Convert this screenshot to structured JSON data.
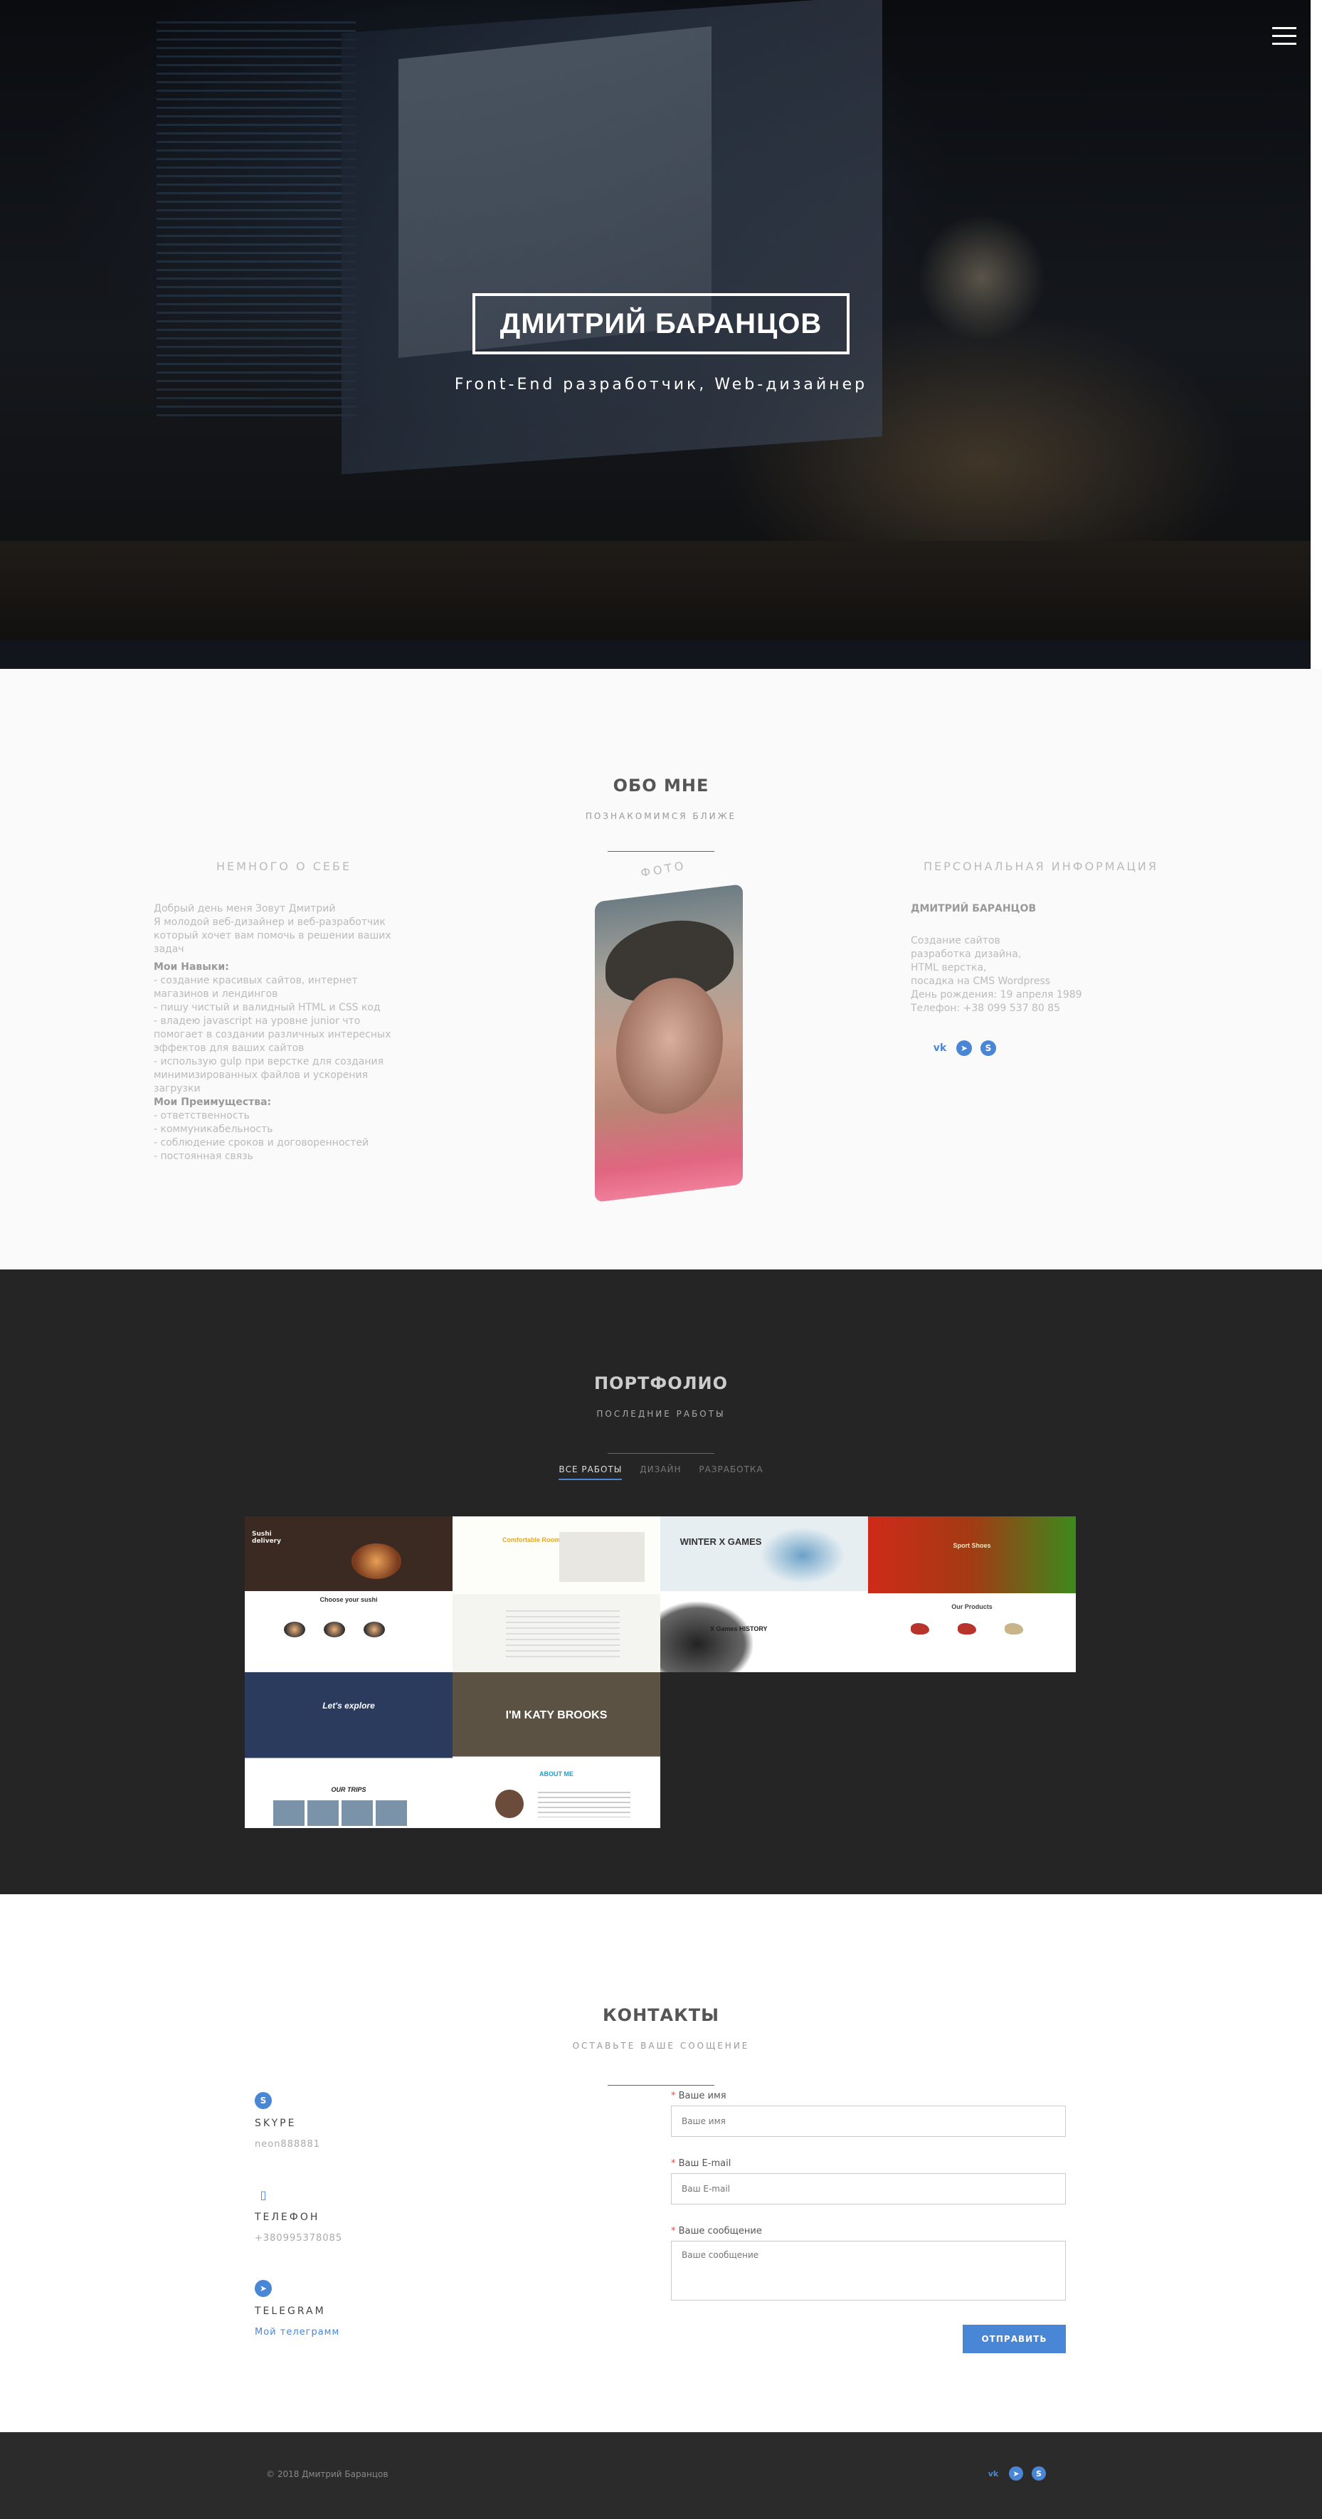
{
  "hero": {
    "title": "ДМИТРИЙ БАРАНЦОВ",
    "subtitle": "Front-End разработчик, Web-дизайнер",
    "menu_icon": "hamburger-icon"
  },
  "about": {
    "title": "ОБО МНЕ",
    "subtitle": "ПОЗНАКОМИМСЯ БЛИЖЕ",
    "left_heading": "НЕМНОГО О СЕБЕ",
    "intro": "Добрый день меня Зовут Дмитрий\nЯ молодой веб-дизайнер и веб-разработчик который хочет вам помочь в решении ваших задач",
    "skills_heading": "Мои Навыки:",
    "skills": [
      "- создание красивых сайтов, интернет магазинов и лендингов",
      "- пишу чистый и валидный HTML и CSS код",
      "- владею javascript на уровне junior что помогает в создании различных интересных эффектов для ваших сайтов",
      "- использую gulp при верстке для создания минимизированных файлов и ускорения загрузки"
    ],
    "advantages_heading": "Мои Преимущества:",
    "advantages": [
      "- ответственность",
      "- коммуникабельность",
      "- соблюдение сроков и договоренностей",
      "- постоянная связь"
    ],
    "photo_label": "ФОТО",
    "right_heading": "ПЕРСОНАЛЬНАЯ ИНФОРМАЦИЯ",
    "name": "ДМИТРИЙ БАРАНЦОВ",
    "info": [
      "Создание сайтов",
      "разработка дизайна,",
      "HTML верстка,",
      "посадка на CMS Wordpress",
      "День рождения: 19 апреля 1989",
      "Телефон: +38 099 537 80 85"
    ],
    "socials": [
      "vk-icon",
      "telegram-icon",
      "skype-icon"
    ]
  },
  "portfolio": {
    "title": "ПОРТФОЛИО",
    "subtitle": "ПОСЛЕДНИЕ РАБОТЫ",
    "filters": [
      "ВСЕ РАБОТЫ",
      "ДИЗАЙН",
      "РАЗРАБОТКА"
    ],
    "active_filter": "ВСЕ РАБОТЫ",
    "tiles": {
      "t1_header": "Sushi delivery",
      "t1_label": "Choose your sushi",
      "t2_label": "Comfortable Rooms",
      "t3_label": "WINTER X GAMES",
      "t3_label2": "X Games HISTORY",
      "t4_label": "Sport Shoes",
      "t4_label2": "Our Products",
      "t5_label": "Let's explore",
      "t5_label2": "OUR TRIPS",
      "t6_label": "I'M KATY BROOKS",
      "t6_label2": "ABOUT ME"
    }
  },
  "contacts": {
    "title": "КОНТАКТЫ",
    "subtitle": "ОСТАВЬТЕ ВАШЕ СООЩЕНИЕ",
    "skype_label": "SKYPE",
    "skype_value": "neon888881",
    "phone_label": "ТЕЛЕФОН",
    "phone_value": "+380995378085",
    "telegram_label": "TELEGRAM",
    "telegram_value": "Мой телеграмм",
    "form": {
      "name_label": "Ваше имя",
      "name_placeholder": "Ваше имя",
      "email_label": "Ваш E-mail",
      "email_placeholder": "Ваш E-mail",
      "message_label": "Ваше сообщение",
      "message_placeholder": "Ваше сообщение",
      "submit": "ОТПРАВИТЬ",
      "required_mark": "*"
    }
  },
  "footer": {
    "copyright": "© 2018 Дмитрий Баранцов"
  },
  "colors": {
    "accent": "#4a86d6",
    "dark": "#252525",
    "light": "#fafafa"
  }
}
